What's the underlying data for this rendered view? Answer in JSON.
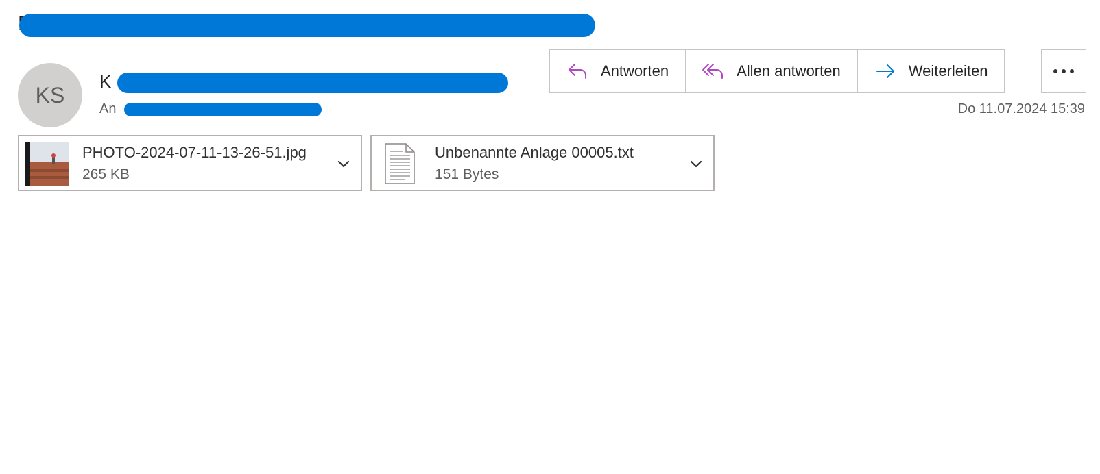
{
  "message": {
    "subject": "D",
    "sender_initial": "K",
    "avatar_initials": "KS",
    "recipient_label": "An",
    "date": "Do 11.07.2024 15:39"
  },
  "actions": {
    "reply": {
      "label": "Antworten",
      "icon": "reply-icon"
    },
    "reply_all": {
      "label": "Allen antworten",
      "icon": "reply-all-icon"
    },
    "forward": {
      "label": "Weiterleiten",
      "icon": "forward-icon"
    },
    "more": {
      "icon": "more-icon"
    }
  },
  "attachments": [
    {
      "name": "PHOTO-2024-07-11-13-26-51.jpg",
      "size": "265 KB",
      "icon": "image-thumbnail"
    },
    {
      "name": "Unbenannte Anlage 00005.txt",
      "size": "151 Bytes",
      "icon": "text-file-icon"
    }
  ],
  "colors": {
    "redaction": "#0078d7",
    "reply_accent": "#b146c2",
    "forward_accent": "#0078d4",
    "avatar_bg": "#d2d0ce",
    "border": "#c8c6c4"
  }
}
